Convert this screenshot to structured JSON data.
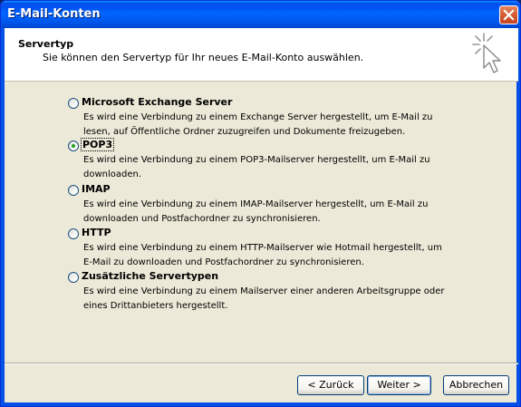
{
  "window": {
    "title": "E-Mail-Konten"
  },
  "header": {
    "title": "Servertyp",
    "subtitle": "Sie können den Servertyp für Ihr neues E-Mail-Konto auswählen."
  },
  "options": [
    {
      "label": "Microsoft Exchange Server",
      "checked": false,
      "desc": "Es wird eine Verbindung zu einem Exchange Server hergestellt, um E-Mail zu lesen, auf Öffentliche Ordner zuzugreifen und Dokumente freizugeben."
    },
    {
      "label": "POP3",
      "checked": true,
      "desc": "Es wird eine Verbindung zu einem POP3-Mailserver hergestellt, um E-Mail zu downloaden."
    },
    {
      "label": "IMAP",
      "checked": false,
      "desc": "Es wird eine Verbindung zu einem IMAP-Mailserver hergestellt, um E-Mail zu downloaden und Postfachordner zu synchronisieren."
    },
    {
      "label": "HTTP",
      "checked": false,
      "desc": "Es wird eine Verbindung zu einem HTTP-Mailserver wie Hotmail hergestellt, um E-Mail zu downloaden und Postfachordner zu synchronisieren."
    },
    {
      "label": "Zusätzliche Servertypen",
      "checked": false,
      "desc": "Es wird eine Verbindung zu einem Mailserver einer anderen Arbeitsgruppe oder eines Drittanbieters hergestellt."
    }
  ],
  "buttons": {
    "back": "< Zurück",
    "next": "Weiter >",
    "cancel": "Abbrechen"
  },
  "icons": {
    "close": "close-icon",
    "wizard": "wizard-sparkle-cursor-icon"
  },
  "colors": {
    "titlebar": "#0054e3",
    "radio_selected": "#21a121",
    "dialog_bg": "#ece9d8"
  }
}
